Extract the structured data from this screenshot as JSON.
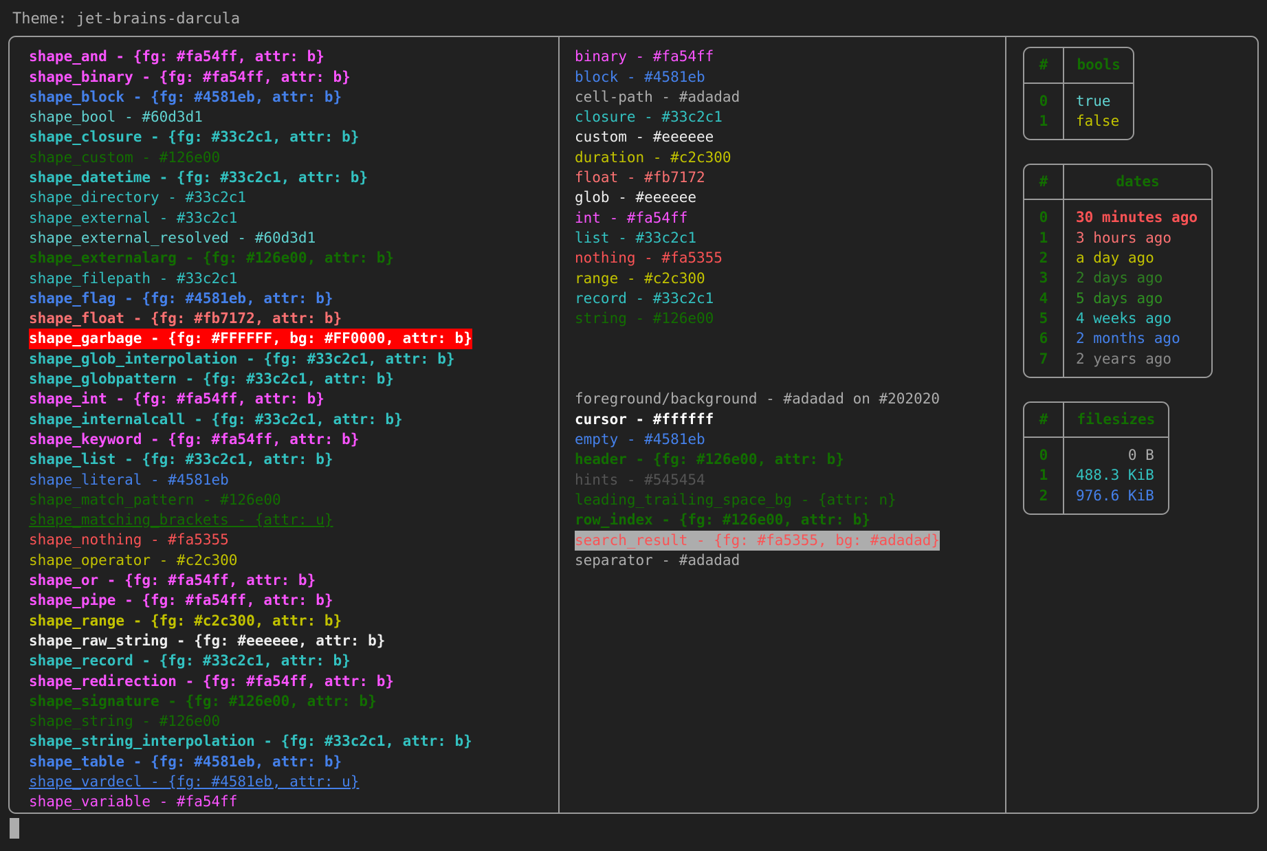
{
  "header": {
    "label": "Theme: jet-brains-darcula"
  },
  "colors": {
    "magenta": "#fa54ff",
    "blue": "#4581eb",
    "cyan_dark": "#60d3d1",
    "cyan": "#33c2c1",
    "green_dark": "#126e00",
    "red_soft": "#fb7172",
    "red": "#fa5355",
    "yellow": "#c2c300",
    "white": "#eeeeee",
    "gray": "#adadad",
    "gray_dim": "#545454",
    "background": "#202020",
    "cursor": "#ffffff",
    "garbage_fg": "#FFFFFF",
    "garbage_bg": "#FF0000"
  },
  "shapes": [
    {
      "text": "shape_and - {fg: #fa54ff, attr: b}",
      "fg": "#fa54ff",
      "bold": true
    },
    {
      "text": "shape_binary - {fg: #fa54ff, attr: b}",
      "fg": "#fa54ff",
      "bold": true
    },
    {
      "text": "shape_block - {fg: #4581eb, attr: b}",
      "fg": "#4581eb",
      "bold": true
    },
    {
      "text": "shape_bool - #60d3d1",
      "fg": "#60d3d1",
      "bold": false
    },
    {
      "text": "shape_closure - {fg: #33c2c1, attr: b}",
      "fg": "#33c2c1",
      "bold": true
    },
    {
      "text": "shape_custom - #126e00",
      "fg": "#126e00",
      "bold": false
    },
    {
      "text": "shape_datetime - {fg: #33c2c1, attr: b}",
      "fg": "#33c2c1",
      "bold": true
    },
    {
      "text": "shape_directory - #33c2c1",
      "fg": "#33c2c1",
      "bold": false
    },
    {
      "text": "shape_external - #33c2c1",
      "fg": "#33c2c1",
      "bold": false
    },
    {
      "text": "shape_external_resolved - #60d3d1",
      "fg": "#60d3d1",
      "bold": false
    },
    {
      "text": "shape_externalarg - {fg: #126e00, attr: b}",
      "fg": "#126e00",
      "bold": true
    },
    {
      "text": "shape_filepath - #33c2c1",
      "fg": "#33c2c1",
      "bold": false
    },
    {
      "text": "shape_flag - {fg: #4581eb, attr: b}",
      "fg": "#4581eb",
      "bold": true
    },
    {
      "text": "shape_float - {fg: #fb7172, attr: b}",
      "fg": "#fb7172",
      "bold": true
    },
    {
      "text": "shape_garbage - {fg: #FFFFFF, bg: #FF0000, attr: b}",
      "fg": "#FFFFFF",
      "bg": "#FF0000",
      "bold": true
    },
    {
      "text": "shape_glob_interpolation - {fg: #33c2c1, attr: b}",
      "fg": "#33c2c1",
      "bold": true
    },
    {
      "text": "shape_globpattern - {fg: #33c2c1, attr: b}",
      "fg": "#33c2c1",
      "bold": true
    },
    {
      "text": "shape_int - {fg: #fa54ff, attr: b}",
      "fg": "#fa54ff",
      "bold": true
    },
    {
      "text": "shape_internalcall - {fg: #33c2c1, attr: b}",
      "fg": "#33c2c1",
      "bold": true
    },
    {
      "text": "shape_keyword - {fg: #fa54ff, attr: b}",
      "fg": "#fa54ff",
      "bold": true
    },
    {
      "text": "shape_list - {fg: #33c2c1, attr: b}",
      "fg": "#33c2c1",
      "bold": true
    },
    {
      "text": "shape_literal - #4581eb",
      "fg": "#4581eb",
      "bold": false
    },
    {
      "text": "shape_match_pattern - #126e00",
      "fg": "#126e00",
      "bold": false
    },
    {
      "text": "shape_matching_brackets - {attr: u}",
      "fg": "#126e00",
      "bold": false,
      "underline": true
    },
    {
      "text": "shape_nothing - #fa5355",
      "fg": "#fa5355",
      "bold": false
    },
    {
      "text": "shape_operator - #c2c300",
      "fg": "#c2c300",
      "bold": false
    },
    {
      "text": "shape_or - {fg: #fa54ff, attr: b}",
      "fg": "#fa54ff",
      "bold": true
    },
    {
      "text": "shape_pipe - {fg: #fa54ff, attr: b}",
      "fg": "#fa54ff",
      "bold": true
    },
    {
      "text": "shape_range - {fg: #c2c300, attr: b}",
      "fg": "#c2c300",
      "bold": true
    },
    {
      "text": "shape_raw_string - {fg: #eeeeee, attr: b}",
      "fg": "#eeeeee",
      "bold": true
    },
    {
      "text": "shape_record - {fg: #33c2c1, attr: b}",
      "fg": "#33c2c1",
      "bold": true
    },
    {
      "text": "shape_redirection - {fg: #fa54ff, attr: b}",
      "fg": "#fa54ff",
      "bold": true
    },
    {
      "text": "shape_signature - {fg: #126e00, attr: b}",
      "fg": "#126e00",
      "bold": true
    },
    {
      "text": "shape_string - #126e00",
      "fg": "#126e00",
      "bold": false
    },
    {
      "text": "shape_string_interpolation - {fg: #33c2c1, attr: b}",
      "fg": "#33c2c1",
      "bold": true
    },
    {
      "text": "shape_table - {fg: #4581eb, attr: b}",
      "fg": "#4581eb",
      "bold": true
    },
    {
      "text": "shape_vardecl - {fg: #4581eb, attr: u}",
      "fg": "#4581eb",
      "bold": false,
      "underline": true
    },
    {
      "text": "shape_variable - #fa54ff",
      "fg": "#fa54ff",
      "bold": false
    }
  ],
  "types": [
    {
      "text": "binary - #fa54ff",
      "fg": "#fa54ff",
      "bold": false
    },
    {
      "text": "block - #4581eb",
      "fg": "#4581eb",
      "bold": false
    },
    {
      "text": "cell-path - #adadad",
      "fg": "#adadad",
      "bold": false
    },
    {
      "text": "closure - #33c2c1",
      "fg": "#33c2c1",
      "bold": false
    },
    {
      "text": "custom - #eeeeee",
      "fg": "#eeeeee",
      "bold": false
    },
    {
      "text": "duration - #c2c300",
      "fg": "#c2c300",
      "bold": false
    },
    {
      "text": "float - #fb7172",
      "fg": "#fb7172",
      "bold": false
    },
    {
      "text": "glob - #eeeeee",
      "fg": "#eeeeee",
      "bold": false
    },
    {
      "text": "int - #fa54ff",
      "fg": "#fa54ff",
      "bold": false
    },
    {
      "text": "list - #33c2c1",
      "fg": "#33c2c1",
      "bold": false
    },
    {
      "text": "nothing - #fa5355",
      "fg": "#fa5355",
      "bold": false
    },
    {
      "text": "range - #c2c300",
      "fg": "#c2c300",
      "bold": false
    },
    {
      "text": "record - #33c2c1",
      "fg": "#33c2c1",
      "bold": false
    },
    {
      "text": "string - #126e00",
      "fg": "#126e00",
      "bold": false
    }
  ],
  "ui_elements": [
    {
      "text": "foreground/background - #adadad on #202020",
      "fg": "#adadad",
      "bold": false
    },
    {
      "text": "cursor - #ffffff",
      "fg": "#ffffff",
      "bold": true
    },
    {
      "text": "empty - #4581eb",
      "fg": "#4581eb",
      "bold": false
    },
    {
      "text": "header - {fg: #126e00, attr: b}",
      "fg": "#126e00",
      "bold": true
    },
    {
      "text": "hints - #545454",
      "fg": "#545454",
      "bold": false
    },
    {
      "text": "leading_trailing_space_bg - {attr: n}",
      "fg": "#126e00",
      "bold": false
    },
    {
      "text": "row_index - {fg: #126e00, attr: b}",
      "fg": "#126e00",
      "bold": true
    },
    {
      "text": "search_result - {fg: #fa5355, bg: #adadad}",
      "fg": "#fa5355",
      "bg": "#adadad",
      "bold": false
    },
    {
      "text": "separator - #adadad",
      "fg": "#adadad",
      "bold": false
    }
  ],
  "tables": [
    {
      "name": "bools",
      "columns": [
        "#",
        "bools"
      ],
      "rows": [
        {
          "index": "0",
          "value": "true",
          "fg": "#60d3d1",
          "bold": false
        },
        {
          "index": "1",
          "value": "false",
          "fg": "#c2c300",
          "bold": false
        }
      ],
      "align": "left"
    },
    {
      "name": "dates",
      "columns": [
        "#",
        "dates"
      ],
      "rows": [
        {
          "index": "0",
          "value": "30 minutes ago",
          "fg": "#fa5355",
          "bold": true
        },
        {
          "index": "1",
          "value": "3 hours ago",
          "fg": "#fb7172",
          "bold": false
        },
        {
          "index": "2",
          "value": "a day ago",
          "fg": "#c2c300",
          "bold": false
        },
        {
          "index": "3",
          "value": "2 days ago",
          "fg": "#2f7f22",
          "bold": false
        },
        {
          "index": "4",
          "value": "5 days ago",
          "fg": "#2f8f22",
          "bold": false
        },
        {
          "index": "5",
          "value": "4 weeks ago",
          "fg": "#33c2c1",
          "bold": false
        },
        {
          "index": "6",
          "value": "2 months ago",
          "fg": "#4581eb",
          "bold": false
        },
        {
          "index": "7",
          "value": "2 years ago",
          "fg": "#8a8a8a",
          "bold": false
        }
      ],
      "align": "left"
    },
    {
      "name": "filesizes",
      "columns": [
        "#",
        "filesizes"
      ],
      "rows": [
        {
          "index": "0",
          "value": "0 B",
          "fg": "#adadad",
          "bold": false
        },
        {
          "index": "1",
          "value": "488.3 KiB",
          "fg": "#33c2c1",
          "bold": false
        },
        {
          "index": "2",
          "value": "976.6 KiB",
          "fg": "#4581eb",
          "bold": false
        }
      ],
      "align": "right"
    }
  ]
}
